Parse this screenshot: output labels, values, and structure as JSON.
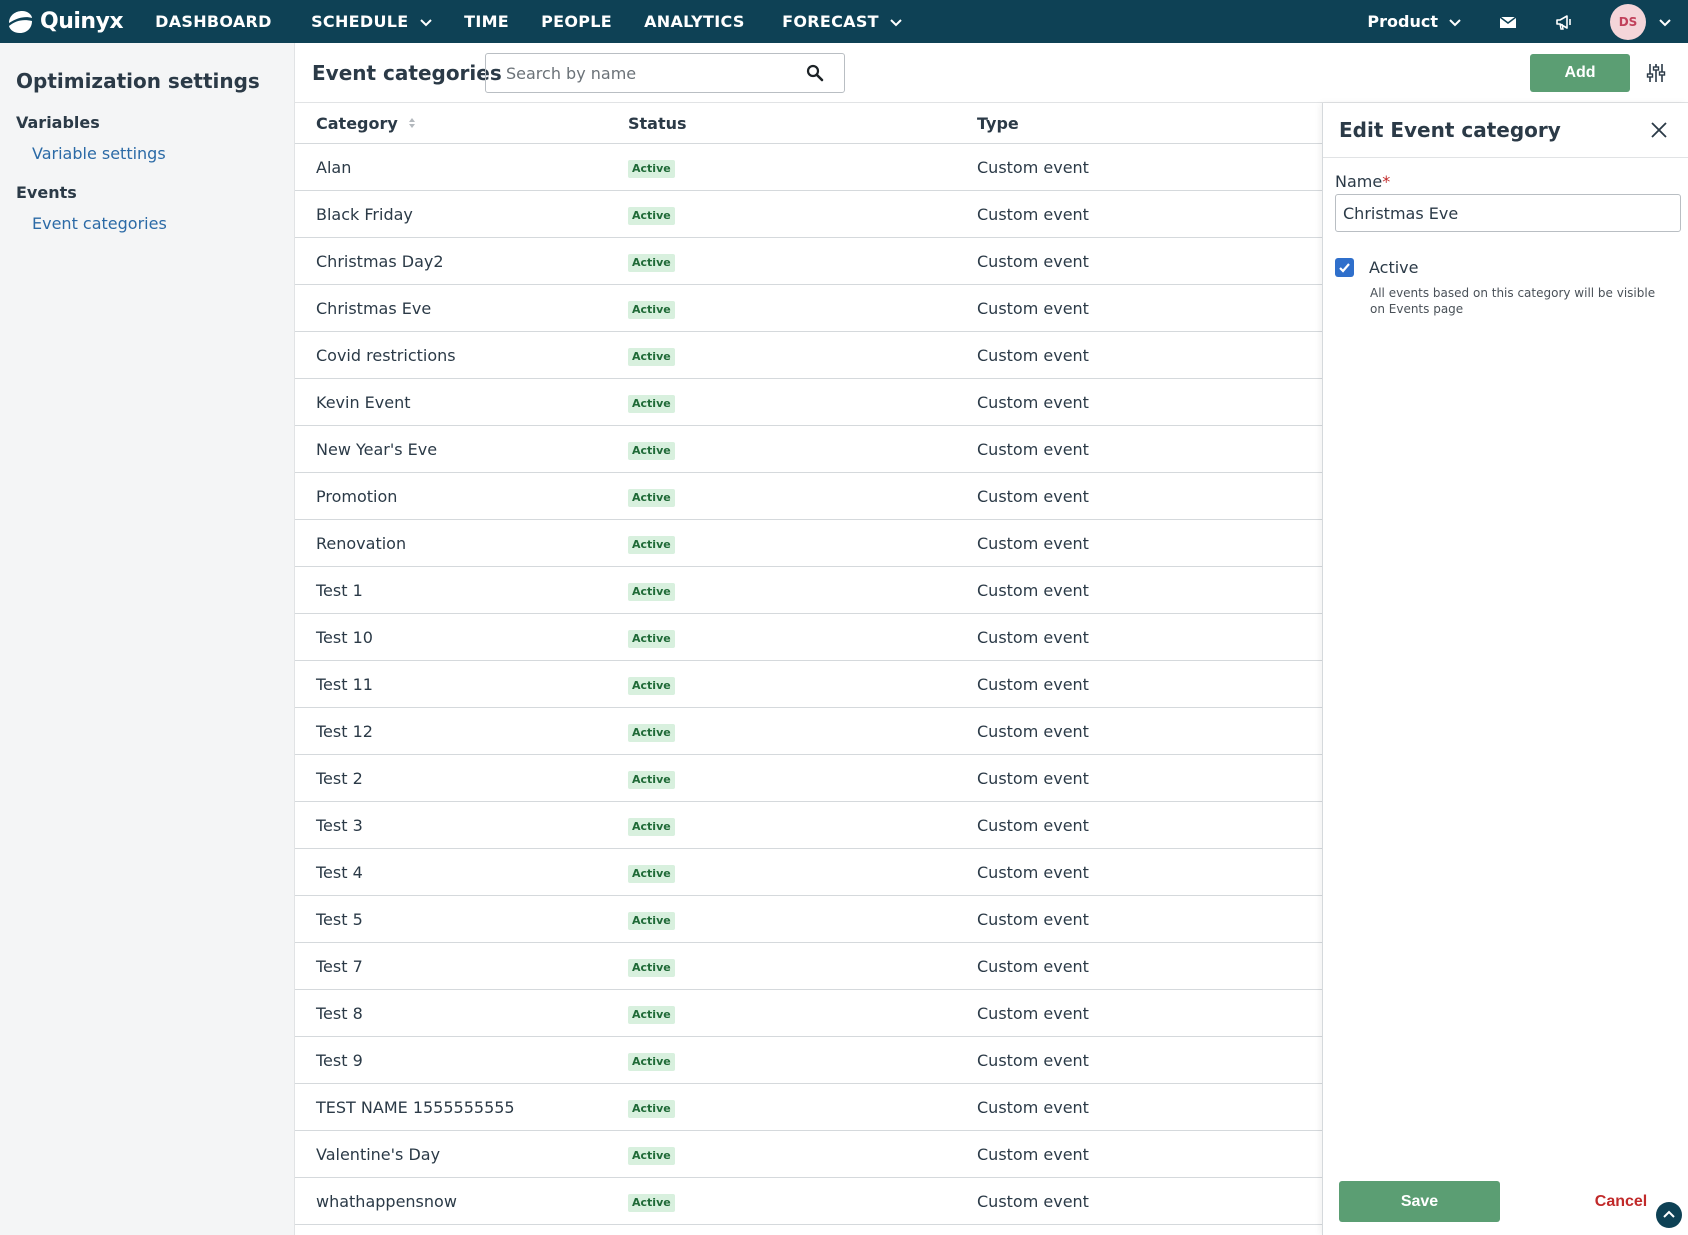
{
  "topbar": {
    "logo_text": "Quinyx",
    "nav": [
      {
        "label": "DASHBOARD",
        "has_dropdown": false
      },
      {
        "label": "SCHEDULE",
        "has_dropdown": true
      },
      {
        "label": "TIME",
        "has_dropdown": false
      },
      {
        "label": "PEOPLE",
        "has_dropdown": false
      },
      {
        "label": "ANALYTICS",
        "has_dropdown": false
      },
      {
        "label": "FORECAST",
        "has_dropdown": true
      }
    ],
    "product_label": "Product",
    "avatar_initials": "DS"
  },
  "sidebar": {
    "title": "Optimization settings",
    "groups": [
      {
        "label": "Variables",
        "links": [
          "Variable settings"
        ]
      },
      {
        "label": "Events",
        "links": [
          "Event categories"
        ]
      }
    ]
  },
  "header": {
    "title": "Event categories",
    "search_placeholder": "Search by name",
    "add_label": "Add"
  },
  "table": {
    "columns": [
      "Category",
      "Status",
      "Type"
    ],
    "rows": [
      {
        "category": "Alan",
        "status": "Active",
        "type": "Custom event"
      },
      {
        "category": "Black Friday",
        "status": "Active",
        "type": "Custom event"
      },
      {
        "category": "Christmas Day2",
        "status": "Active",
        "type": "Custom event"
      },
      {
        "category": "Christmas Eve",
        "status": "Active",
        "type": "Custom event"
      },
      {
        "category": "Covid restrictions",
        "status": "Active",
        "type": "Custom event"
      },
      {
        "category": "Kevin Event",
        "status": "Active",
        "type": "Custom event"
      },
      {
        "category": "New Year's Eve",
        "status": "Active",
        "type": "Custom event"
      },
      {
        "category": "Promotion",
        "status": "Active",
        "type": "Custom event"
      },
      {
        "category": "Renovation",
        "status": "Active",
        "type": "Custom event"
      },
      {
        "category": "Test 1",
        "status": "Active",
        "type": "Custom event"
      },
      {
        "category": "Test 10",
        "status": "Active",
        "type": "Custom event"
      },
      {
        "category": "Test 11",
        "status": "Active",
        "type": "Custom event"
      },
      {
        "category": "Test 12",
        "status": "Active",
        "type": "Custom event"
      },
      {
        "category": "Test 2",
        "status": "Active",
        "type": "Custom event"
      },
      {
        "category": "Test 3",
        "status": "Active",
        "type": "Custom event"
      },
      {
        "category": "Test 4",
        "status": "Active",
        "type": "Custom event"
      },
      {
        "category": "Test 5",
        "status": "Active",
        "type": "Custom event"
      },
      {
        "category": "Test 7",
        "status": "Active",
        "type": "Custom event"
      },
      {
        "category": "Test 8",
        "status": "Active",
        "type": "Custom event"
      },
      {
        "category": "Test 9",
        "status": "Active",
        "type": "Custom event"
      },
      {
        "category": "TEST NAME 1555555555",
        "status": "Active",
        "type": "Custom event"
      },
      {
        "category": "Valentine's Day",
        "status": "Active",
        "type": "Custom event"
      },
      {
        "category": "whathappensnow",
        "status": "Active",
        "type": "Custom event"
      }
    ]
  },
  "panel": {
    "title": "Edit Event category",
    "name_label": "Name",
    "required_mark": "*",
    "name_value": "Christmas Eve",
    "active_label": "Active",
    "active_checked": true,
    "active_hint": "All events based on this category will be visible on Events page",
    "save_label": "Save",
    "cancel_label": "Cancel"
  },
  "colors": {
    "topbar": "#0e4155",
    "primary_button": "#5b9e73",
    "link": "#2b6aa6",
    "danger": "#c12a2a",
    "badge_bg": "#d8f0de",
    "checkbox": "#2f6fcb"
  }
}
